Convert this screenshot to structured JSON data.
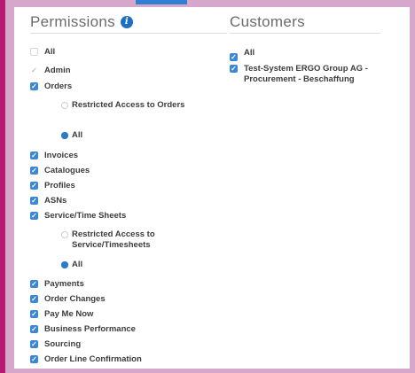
{
  "permissions": {
    "title": "Permissions",
    "info_icon": "info-icon",
    "items": [
      {
        "label": "All",
        "state": "unchecked"
      },
      {
        "label": "Admin",
        "state": "disabled"
      },
      {
        "label": "Orders",
        "state": "checked"
      },
      {
        "label": "Restricted Access to Orders",
        "kind": "radio",
        "state": "off"
      },
      {
        "label": "All",
        "kind": "radio",
        "state": "on"
      },
      {
        "label": "Invoices",
        "state": "checked"
      },
      {
        "label": "Catalogues",
        "state": "checked"
      },
      {
        "label": "Profiles",
        "state": "checked"
      },
      {
        "label": "ASNs",
        "state": "checked"
      },
      {
        "label": "Service/Time Sheets",
        "state": "checked"
      },
      {
        "label": "Restricted Access to Service/Timesheets",
        "kind": "radio",
        "state": "off"
      },
      {
        "label": "All",
        "kind": "radio",
        "state": "on"
      },
      {
        "label": "Payments",
        "state": "checked"
      },
      {
        "label": "Order Changes",
        "state": "checked"
      },
      {
        "label": "Pay Me Now",
        "state": "checked"
      },
      {
        "label": "Business Performance",
        "state": "checked"
      },
      {
        "label": "Sourcing",
        "state": "checked"
      },
      {
        "label": "Order Line Confirmation",
        "state": "checked"
      }
    ]
  },
  "customers": {
    "title": "Customers",
    "items": [
      {
        "label": "All",
        "state": "checked"
      },
      {
        "label": "Test-System ERGO Group AG - Procurement - Beschaffung",
        "state": "checked"
      }
    ]
  },
  "colors": {
    "accent": "#3a87d6",
    "frame": "#d7a6cb",
    "left_bar": "#b8186e"
  }
}
